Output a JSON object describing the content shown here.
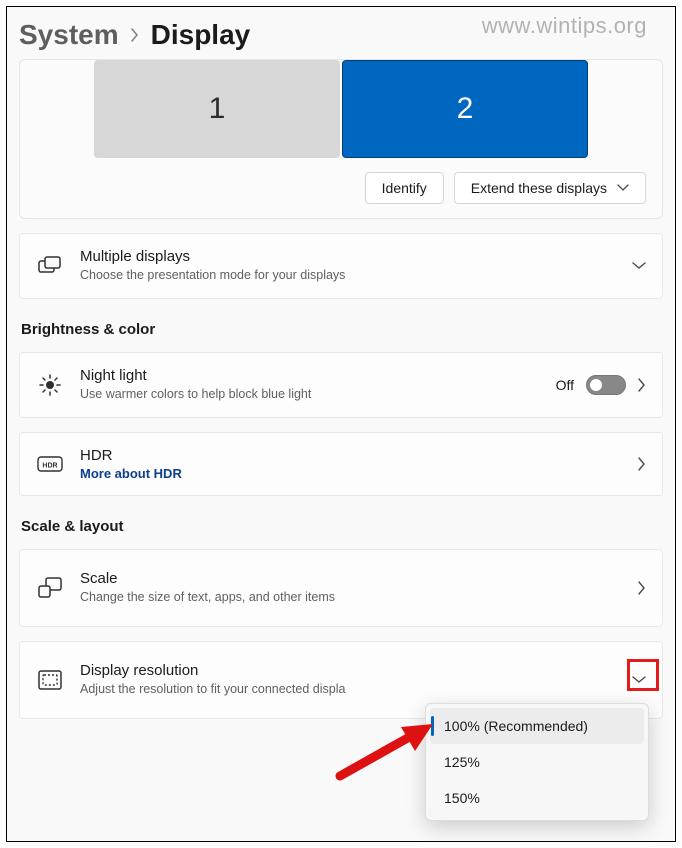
{
  "watermark": "www.wintips.org",
  "breadcrumb": {
    "parent": "System",
    "current": "Display"
  },
  "displays": {
    "d1": "1",
    "d2": "2"
  },
  "arrange": {
    "identify": "Identify",
    "mode": "Extend these displays"
  },
  "multiple": {
    "title": "Multiple displays",
    "sub": "Choose the presentation mode for your displays"
  },
  "sections": {
    "brightness": "Brightness & color",
    "scale_layout": "Scale & layout"
  },
  "night": {
    "title": "Night light",
    "sub": "Use warmer colors to help block blue light",
    "state": "Off"
  },
  "hdr": {
    "title": "HDR",
    "link": "More about HDR"
  },
  "scale": {
    "title": "Scale",
    "sub": "Change the size of text, apps, and other items"
  },
  "scale_options": {
    "o1": "100% (Recommended)",
    "o2": "125%",
    "o3": "150%"
  },
  "resolution": {
    "title": "Display resolution",
    "sub": "Adjust the resolution to fit your connected displa"
  }
}
